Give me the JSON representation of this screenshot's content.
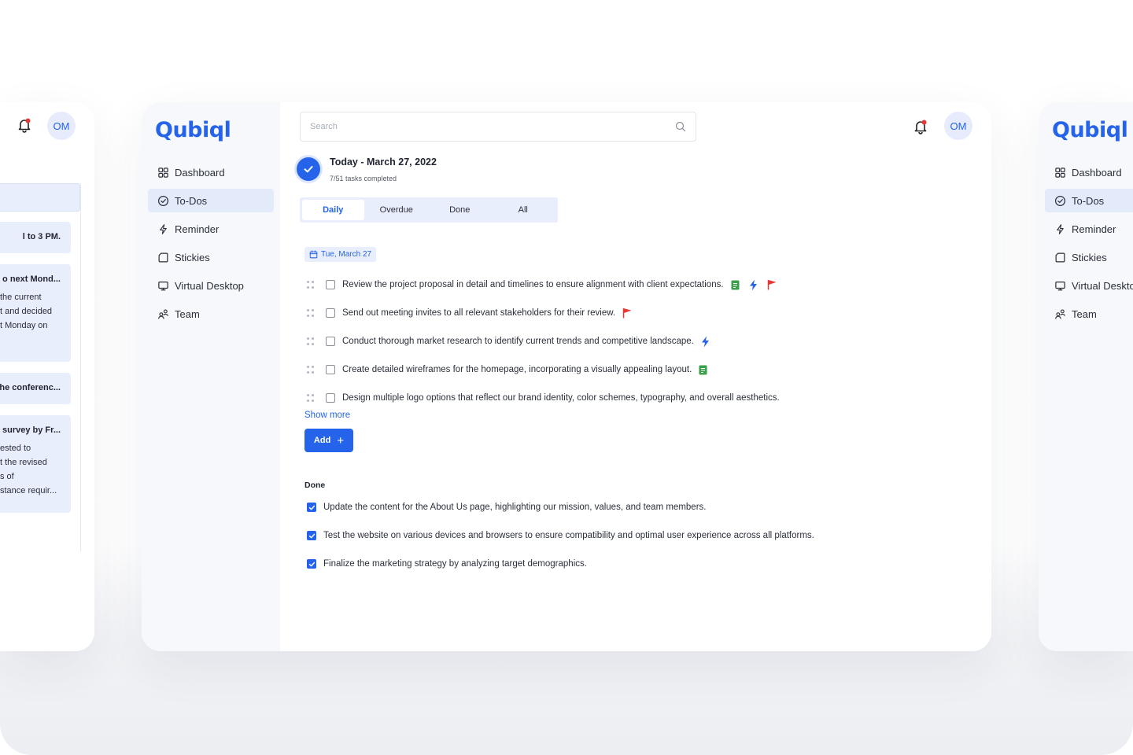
{
  "app": {
    "logo": "Qubiql"
  },
  "sidebar": {
    "items": [
      {
        "label": "Dashboard",
        "icon": "dashboard-icon",
        "active": false
      },
      {
        "label": "To-Dos",
        "icon": "check-circle-icon",
        "active": true
      },
      {
        "label": "Reminder",
        "icon": "lightning-icon",
        "active": false
      },
      {
        "label": "Stickies",
        "icon": "sticky-note-icon",
        "active": false
      },
      {
        "label": "Virtual Desktop",
        "icon": "monitor-icon",
        "active": false
      },
      {
        "label": "Team",
        "icon": "team-icon",
        "active": false
      }
    ]
  },
  "header": {
    "search_placeholder": "Search",
    "avatar_initials": "OM"
  },
  "today": {
    "title": "Today - March 27, 2022",
    "subtitle": "7/51 tasks completed"
  },
  "tabs": [
    {
      "label": "Daily",
      "active": true
    },
    {
      "label": "Overdue",
      "active": false
    },
    {
      "label": "Done",
      "active": false
    },
    {
      "label": "All",
      "active": false
    }
  ],
  "date_chip": "Tue, March 27",
  "tasks": [
    {
      "text": "Review the project proposal in detail and timelines to ensure alignment with client expectations.",
      "tags": [
        "note",
        "bolt",
        "flag"
      ]
    },
    {
      "text": "Send out meeting invites to all relevant stakeholders for their review.",
      "tags": [
        "flag"
      ]
    },
    {
      "text": "Conduct thorough market research to identify current trends and competitive landscape.",
      "tags": [
        "bolt"
      ]
    },
    {
      "text": "Create detailed wireframes for the homepage, incorporating a visually appealing layout.",
      "tags": [
        "note"
      ]
    },
    {
      "text": "Design multiple logo options that reflect our brand identity, color schemes, typography, and overall aesthetics.",
      "tags": []
    }
  ],
  "show_more": "Show more",
  "add_button": "Add",
  "done_section": {
    "title": "Done",
    "items": [
      "Update the content for the About Us page, highlighting our mission, values, and team members.",
      "Test the website on various devices and browsers to ensure compatibility and optimal user experience across all platforms.",
      "Finalize the marketing strategy by analyzing target demographics."
    ]
  },
  "left_card": {
    "avatar_initials": "OM",
    "items": [
      {
        "title": "l to 3 PM.",
        "lines": []
      },
      {
        "title": "o next Mond...",
        "lines": [
          "the current",
          "t and decided",
          "t Monday on"
        ]
      },
      {
        "title": "he conferenc...",
        "lines": []
      },
      {
        "title": "survey by Fr...",
        "lines": [
          "ested to",
          "t the revised",
          "s of",
          "stance requir..."
        ]
      }
    ]
  },
  "right_card": {
    "logo": "Qubiql",
    "items": [
      "Dashboard",
      "To-Dos",
      "Reminder",
      "Stickies",
      "Virtual Desktop",
      "Team"
    ]
  },
  "colors": {
    "accent": "#2563eb",
    "active_bg": "#e3ebfb",
    "sidebar_bg": "#f7f8fb",
    "flag": "#e53935",
    "note": "#3aa04a",
    "notification_dot": "#e53935"
  }
}
